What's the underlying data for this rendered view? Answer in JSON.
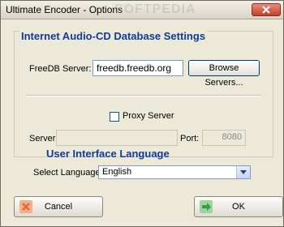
{
  "window": {
    "title": "Ultimate Encoder - Options",
    "watermark": "SOFTPEDIA"
  },
  "audio_cd_group": {
    "title": "Internet Audio-CD Database Settings",
    "freedb_label": "FreeDB Server:",
    "freedb_value": "freedb.freedb.org",
    "browse_label": "Browse Servers...",
    "proxy_label": "Proxy Server",
    "proxy_checked": false,
    "server_label": "Server:",
    "server_value": "",
    "port_label": "Port:",
    "port_value": "8080"
  },
  "language_section": {
    "title": "User Interface Language",
    "select_label": "Select Language:",
    "selected_value": "English"
  },
  "buttons": {
    "cancel_label": "Cancel",
    "ok_label": "OK"
  },
  "colors": {
    "section_title": "#113a9e",
    "cancel_icon": "#e56b3a",
    "ok_icon": "#3a9c4a"
  }
}
